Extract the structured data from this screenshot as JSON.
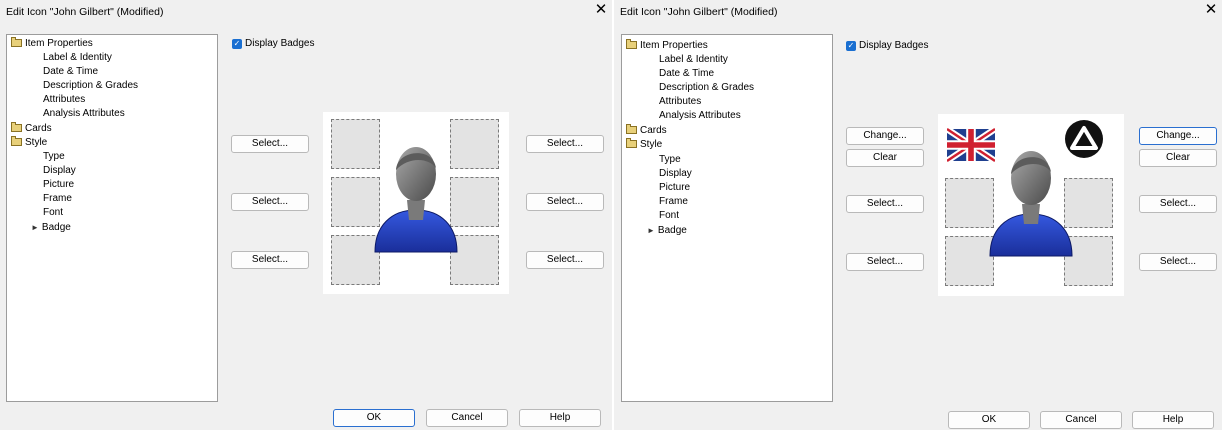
{
  "left": {
    "title": "Edit Icon \"John Gilbert\" (Modified)",
    "close": "✕",
    "display_badges": "Display Badges",
    "tree": [
      {
        "label": "Item Properties",
        "icon": "folder-open-icon"
      },
      {
        "label": "Label & Identity"
      },
      {
        "label": "Date & Time"
      },
      {
        "label": "Description & Grades"
      },
      {
        "label": "Attributes"
      },
      {
        "label": "Analysis Attributes"
      },
      {
        "label": "Cards",
        "icon": "folder-icon"
      },
      {
        "label": "Style",
        "icon": "folder-open-icon"
      },
      {
        "label": "Type"
      },
      {
        "label": "Display"
      },
      {
        "label": "Picture"
      },
      {
        "label": "Frame"
      },
      {
        "label": "Font"
      },
      {
        "label": "Badge",
        "icon": "arrow-right-icon",
        "selected": true
      }
    ],
    "buttons": {
      "select_top_left": "Select...",
      "select_mid_left": "Select...",
      "select_bot_left": "Select...",
      "select_top_right": "Select...",
      "select_mid_right": "Select...",
      "select_bot_right": "Select..."
    },
    "footer": {
      "ok": "OK",
      "cancel": "Cancel",
      "help": "Help"
    }
  },
  "right": {
    "title": "Edit Icon \"John Gilbert\" (Modified)",
    "close": "✕",
    "display_badges": "Display Badges",
    "tree": [
      {
        "label": "Item Properties",
        "icon": "folder-open-icon"
      },
      {
        "label": "Label & Identity"
      },
      {
        "label": "Date & Time"
      },
      {
        "label": "Description & Grades"
      },
      {
        "label": "Attributes"
      },
      {
        "label": "Analysis Attributes"
      },
      {
        "label": "Cards",
        "icon": "folder-icon"
      },
      {
        "label": "Style",
        "icon": "folder-open-icon"
      },
      {
        "label": "Type"
      },
      {
        "label": "Display"
      },
      {
        "label": "Picture"
      },
      {
        "label": "Frame"
      },
      {
        "label": "Font"
      },
      {
        "label": "Badge",
        "icon": "arrow-right-icon",
        "selected": true
      }
    ],
    "buttons": {
      "change_left": "Change...",
      "clear_left": "Clear",
      "change_right": "Change...",
      "clear_right": "Clear",
      "select_mid_left": "Select...",
      "select_bot_left": "Select...",
      "select_mid_right": "Select...",
      "select_bot_right": "Select..."
    },
    "badges": {
      "top_left": "uk-flag-icon",
      "top_right": "warning-triangle-icon"
    },
    "footer": {
      "ok": "OK",
      "cancel": "Cancel",
      "help": "Help"
    }
  },
  "colors": {
    "accent": "#1a6fd1",
    "person_shirt": "#2747c4",
    "dialog_bg": "#f0f0f0"
  }
}
